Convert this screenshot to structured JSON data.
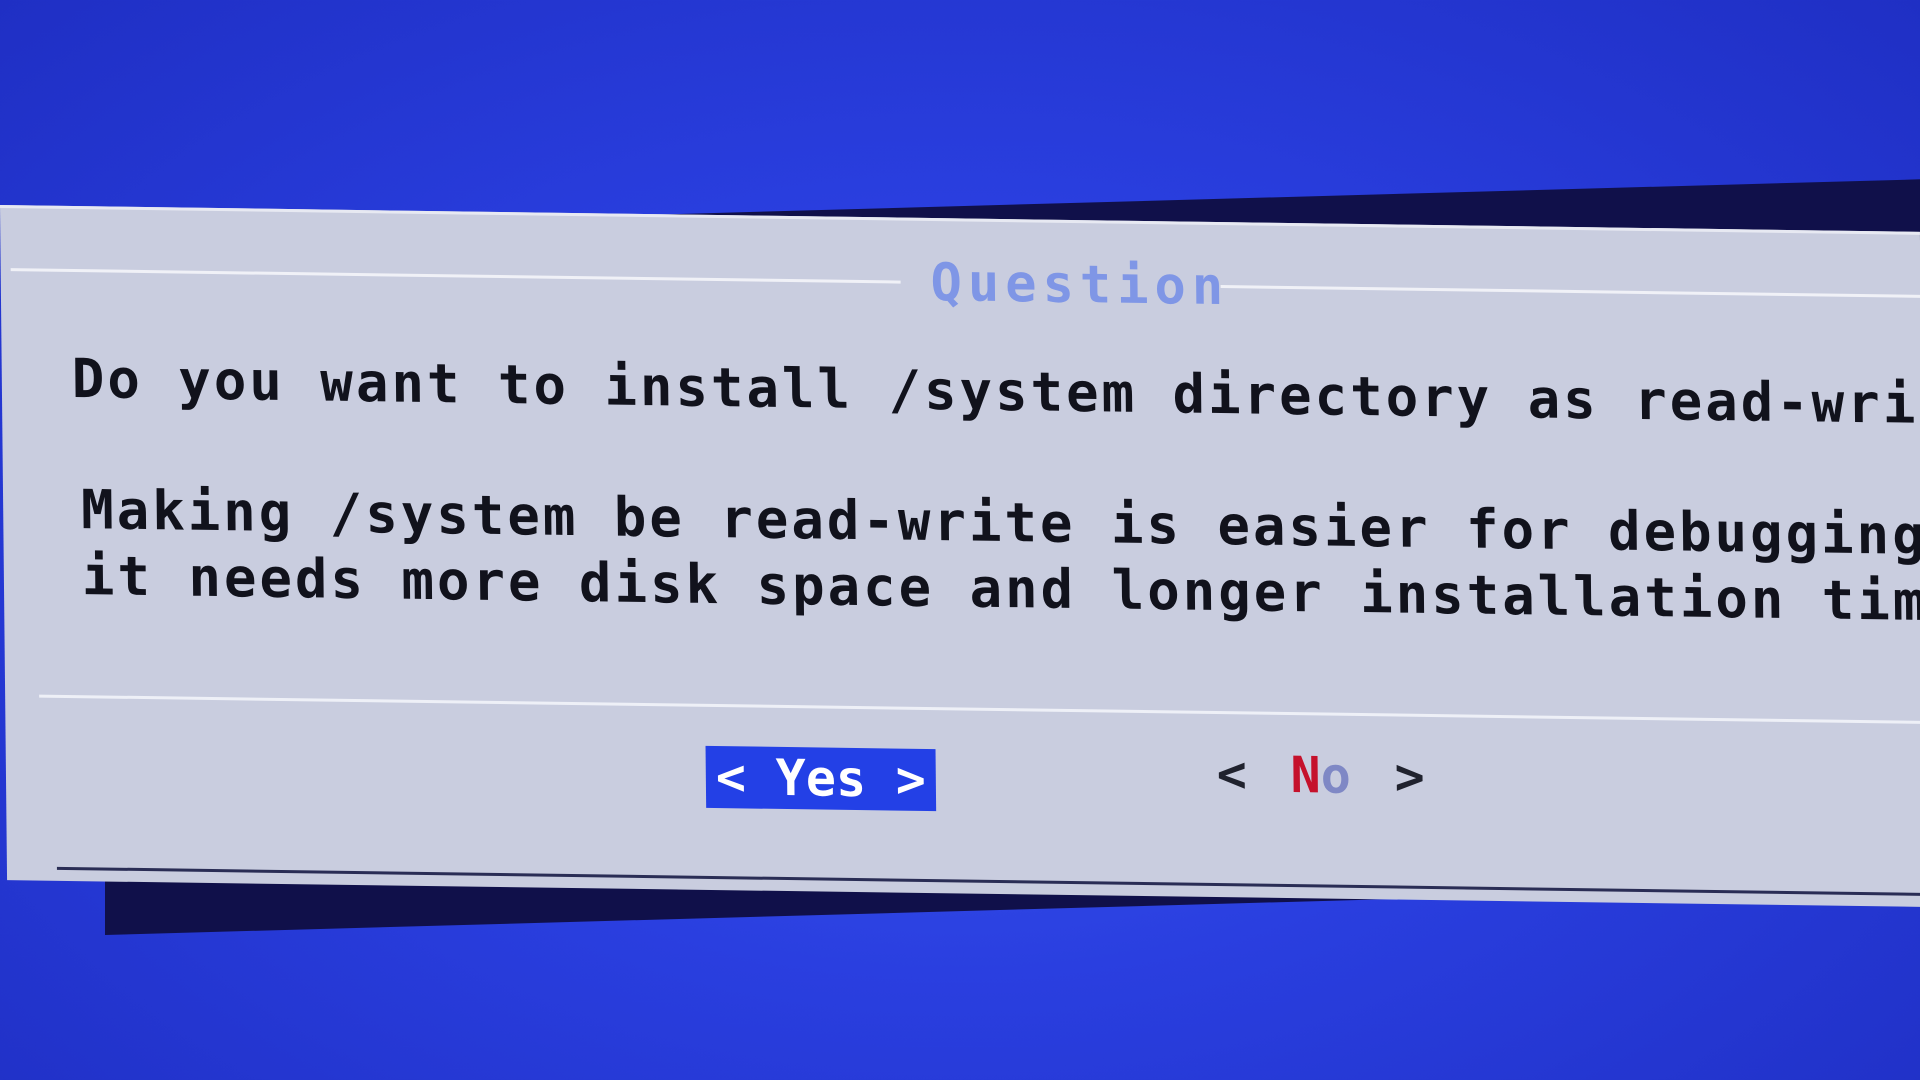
{
  "dialog": {
    "title": "Question",
    "question": "Do you want to install /system directory as read-write?",
    "info_lines": [
      "Making /system be read-write is easier for debugging, but",
      "it needs more disk space and longer installation time."
    ]
  },
  "buttons": {
    "yes": {
      "open": "<",
      "label": "Yes",
      "close": ">"
    },
    "no": {
      "open": "<",
      "hotkey": "N",
      "rest": "o",
      "close": ">"
    }
  },
  "colors": {
    "background": "#2a3fe0",
    "dialog": "#c9cddf",
    "title": "#7f96e6",
    "selected_button": "#2340e6",
    "hotkey": "#c5112c"
  }
}
